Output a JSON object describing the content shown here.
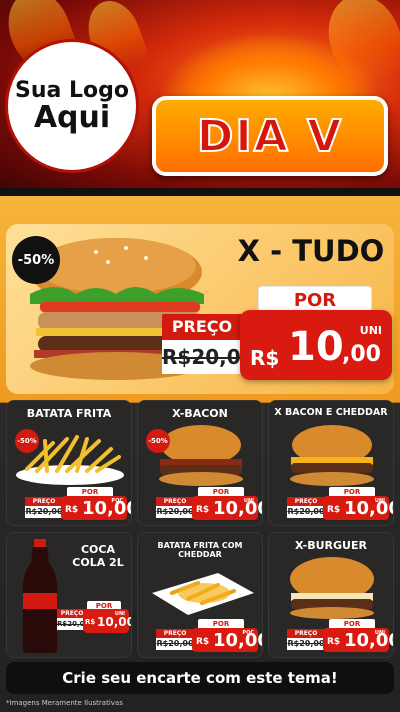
{
  "header": {
    "logo_line1": "Sua Logo",
    "logo_line2": "Aqui",
    "title": "DIA V"
  },
  "featured": {
    "discount": "-50%",
    "name": "X - TUDO",
    "por_label": "POR",
    "preco_label": "PREÇO",
    "old_price": "R$20,00",
    "uni_label": "UNI",
    "currency": "R$",
    "price_int": "10",
    "price_cents": ",00"
  },
  "cards": [
    {
      "title": "BATATA FRITA",
      "discount": "-50%",
      "por": "POR",
      "preco": "PREÇO",
      "old": "R$20,00",
      "currency": "R$",
      "price": "10,00",
      "uni": "POC"
    },
    {
      "title": "X-BACON",
      "discount": "-50%",
      "por": "POR",
      "preco": "PREÇO",
      "old": "R$20,00",
      "currency": "R$",
      "price": "10,00",
      "uni": "UNI"
    },
    {
      "title": "X BACON E CHEDDAR",
      "discount": "",
      "por": "POR",
      "preco": "PREÇO",
      "old": "R$20,00",
      "currency": "R$",
      "price": "10,00",
      "uni": "UNI"
    },
    {
      "title": "COCA COLA 2L",
      "discount": "",
      "por": "POR",
      "preco": "PREÇO",
      "old": "R$20,00",
      "currency": "R$",
      "price": "10,00",
      "uni": "UNI"
    },
    {
      "title": "BATATA FRITA COM CHEDDAR",
      "discount": "",
      "por": "POR",
      "preco": "PREÇO",
      "old": "R$20,00",
      "currency": "R$",
      "price": "10,00",
      "uni": "POC"
    },
    {
      "title": "X-BURGUER",
      "discount": "",
      "por": "POR",
      "preco": "PREÇO",
      "old": "R$20,00",
      "currency": "R$",
      "price": "10,00",
      "uni": "UNI"
    }
  ],
  "cta": "Crie seu encarte com este tema!",
  "note": "*Imagens Meramente Ilustrativas",
  "colors": {
    "accent_red": "#d91a10",
    "orange": "#f7b545",
    "dark": "#2a2826"
  }
}
